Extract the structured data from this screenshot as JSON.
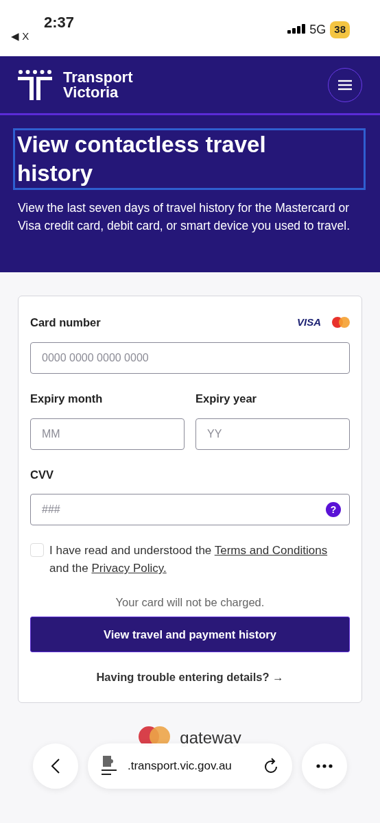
{
  "status_bar": {
    "time": "2:37",
    "back_label": "◀ X",
    "network": "5G",
    "battery": "38"
  },
  "header": {
    "brand": [
      "Transport",
      "Victoria"
    ]
  },
  "hero": {
    "title": "View contactless travel history",
    "focused": true,
    "description": "View the last seven days of travel history for the Mastercard or Visa credit card, debit card, or smart device you used to travel."
  },
  "form": {
    "card_brand": "VISA",
    "fields": [
      {
        "kind": "card",
        "label": "Card number",
        "placeholder": "0000 0000 0000 0000"
      },
      {
        "kind": "half",
        "label": "Expiry month",
        "placeholder": "MM"
      },
      {
        "kind": "half",
        "label": "Expiry year",
        "placeholder": "YY"
      },
      {
        "kind": "cvv",
        "label": "CVV",
        "placeholder": "###",
        "help": "?"
      }
    ],
    "agreement": {
      "checked": false,
      "parts": [
        {
          "kind": "text",
          "text": "I have read and understood the"
        },
        {
          "kind": "link",
          "text": "Terms and Conditions"
        },
        {
          "kind": "text",
          "text": "and the"
        },
        {
          "kind": "link",
          "text": "Privacy Policy."
        }
      ]
    },
    "note": "Your card will not be charged.",
    "submit": "View travel and payment history",
    "help_link": "Having trouble entering details? →"
  },
  "footer": {
    "brand": "gateway"
  },
  "browser_bar": {
    "url": ".transport.vic.gov.au"
  }
}
